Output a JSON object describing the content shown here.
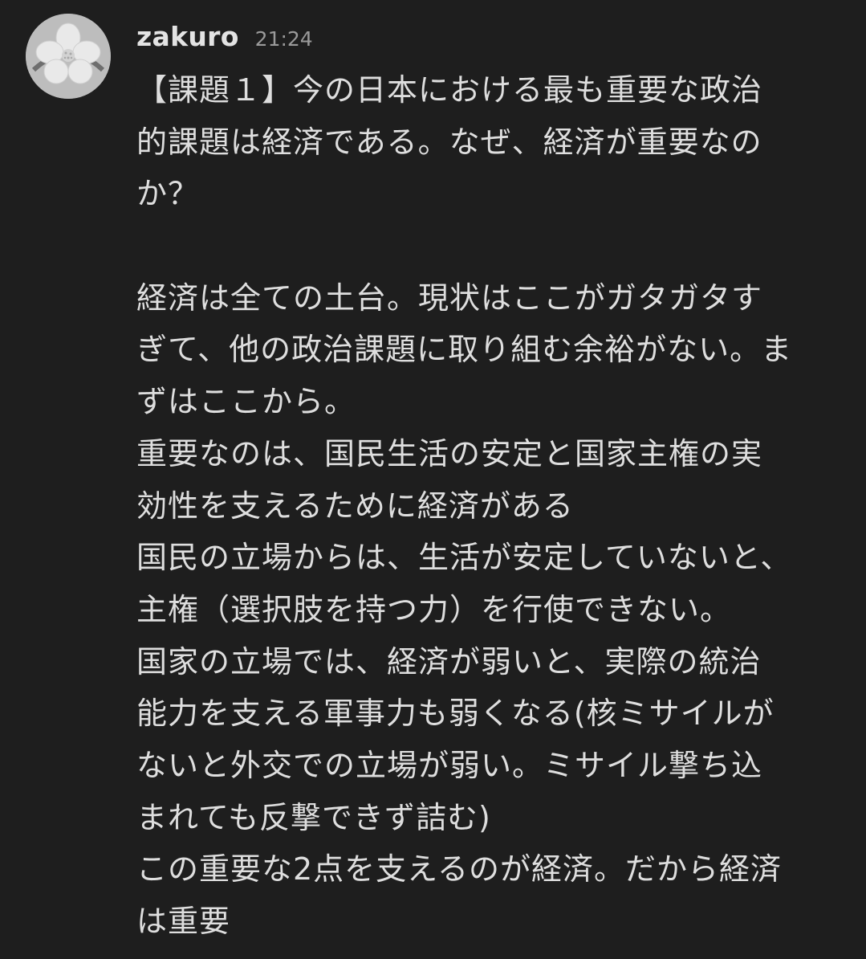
{
  "message": {
    "author": "zakuro",
    "timestamp": "21:24",
    "avatar_icon": "flower-avatar-icon",
    "lines": [
      "【課題１】今の日本における最も重要な政治",
      "的課題は経済である。なぜ、経済が重要なの",
      "か？",
      "",
      "経済は全ての土台。現状はここがガタガタす",
      "ぎて、他の政治課題に取り組む余裕がない。ま",
      "ずはここから。",
      "重要なのは、国民生活の安定と国家主権の実",
      "効性を支えるために経済がある",
      "国民の立場からは、生活が安定していないと、",
      "主権（選択肢を持つ力）を行使できない。",
      "国家の立場では、経済が弱いと、実際の統治",
      "能力を支える軍事力も弱くなる(核ミサイルが",
      "ないと外交での立場が弱い。ミサイル撃ち込",
      "まれても反撃できず詰む)",
      "この重要な2点を支えるのが経済。だから経済",
      "は重要"
    ]
  },
  "colors": {
    "background": "#1e1e1e",
    "username": "#e3e3e3",
    "timestamp": "#9a9a9a",
    "text": "#dedede"
  }
}
